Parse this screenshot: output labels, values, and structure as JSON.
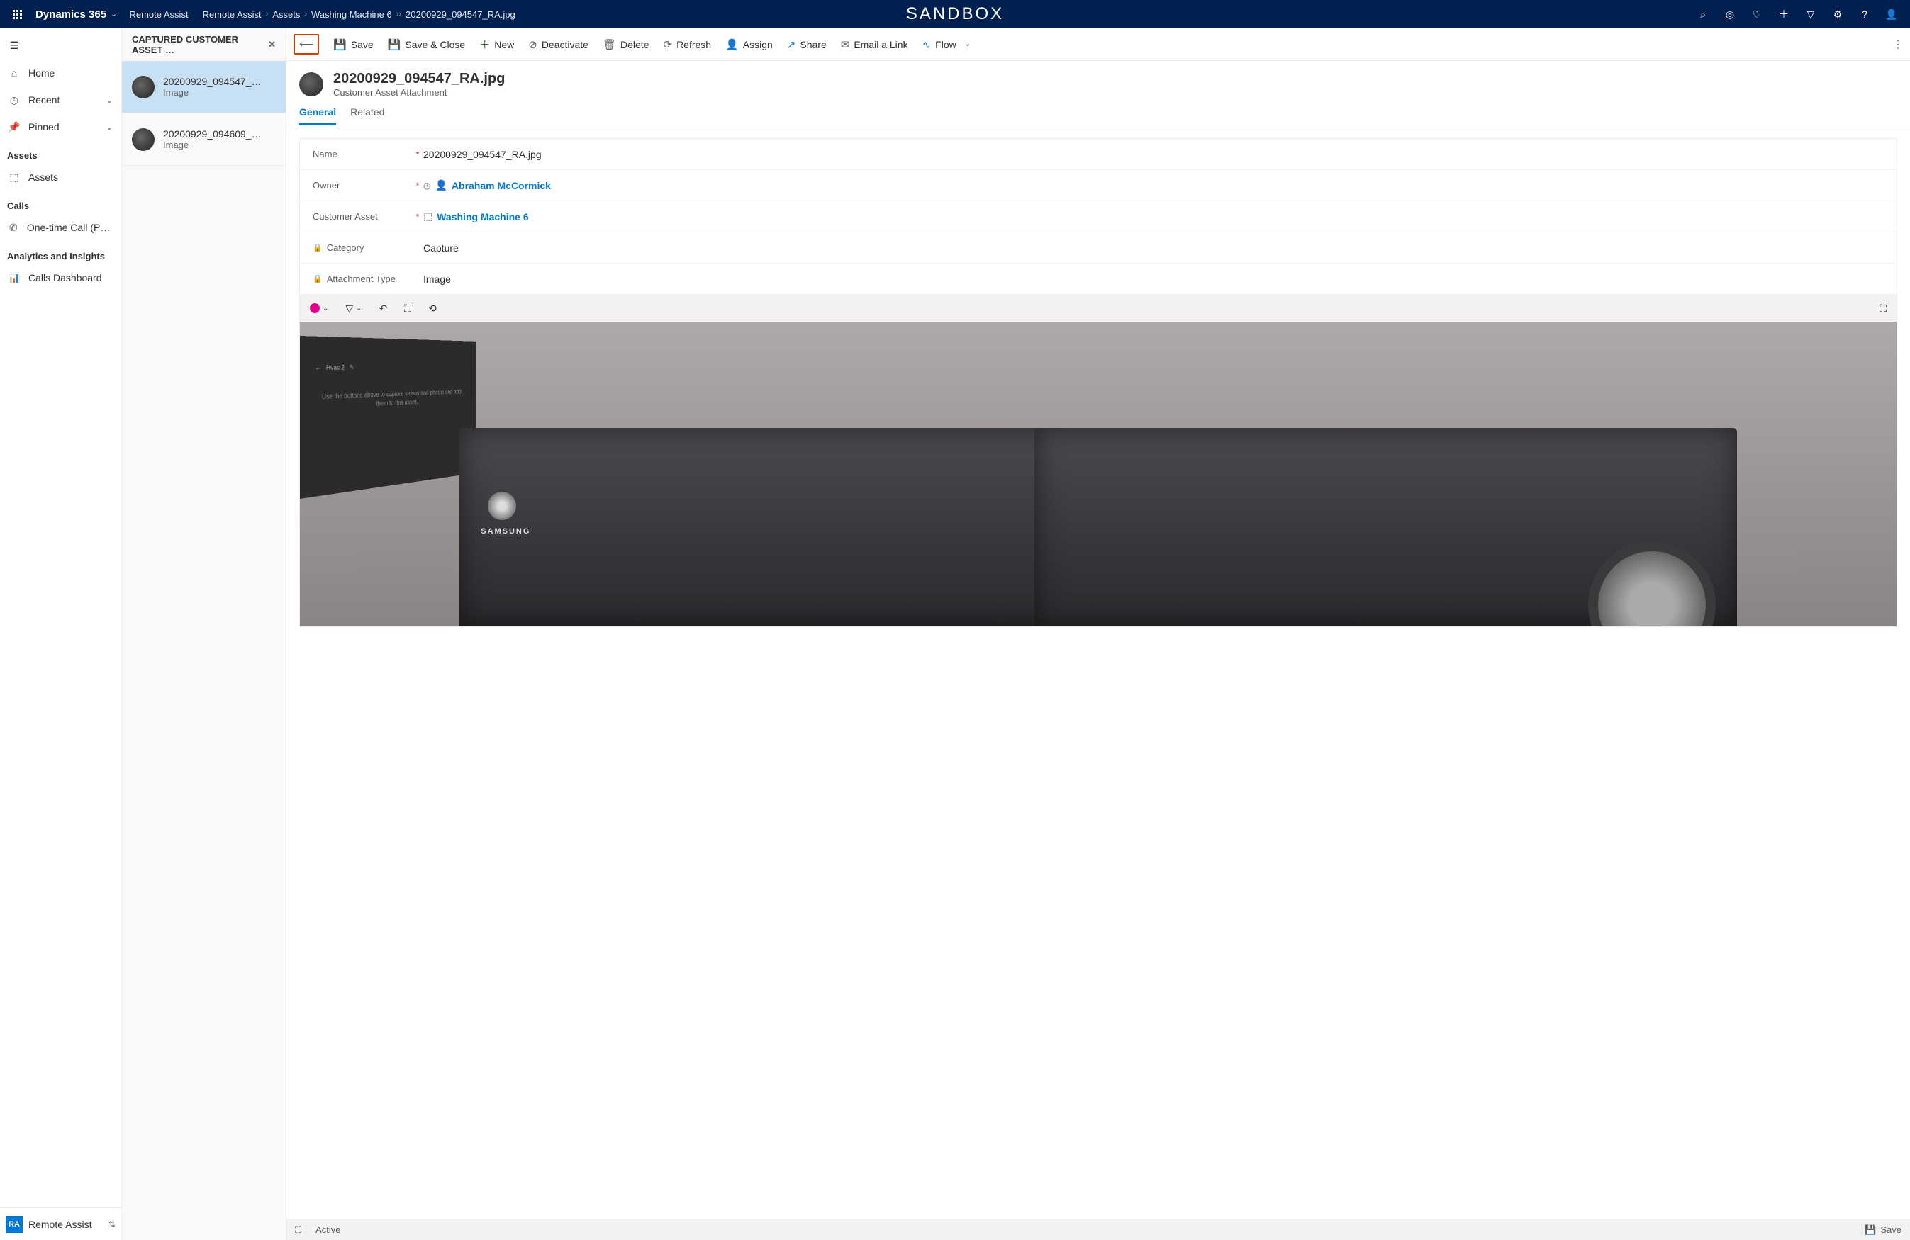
{
  "top": {
    "brand": "Dynamics 365",
    "sandbox": "SANDBOX",
    "breadcrumb": [
      "Remote Assist",
      "Remote Assist",
      "Assets",
      "Washing Machine 6",
      "20200929_094547_RA.jpg"
    ]
  },
  "leftnav": {
    "items_top": [
      {
        "label": "Home",
        "icon": "⌂"
      },
      {
        "label": "Recent",
        "icon": "◷",
        "caret": true
      },
      {
        "label": "Pinned",
        "icon": "📌",
        "caret": true
      }
    ],
    "section_assets": "Assets",
    "item_assets": "Assets",
    "section_calls": "Calls",
    "item_calls": "One-time Call (Previ…",
    "section_analytics": "Analytics and Insights",
    "item_dashboard": "Calls Dashboard",
    "footer_badge": "RA",
    "footer_label": "Remote Assist"
  },
  "list": {
    "header": "CAPTURED CUSTOMER ASSET …",
    "items": [
      {
        "title": "20200929_094547_…",
        "sub": "Image"
      },
      {
        "title": "20200929_094609_…",
        "sub": "Image"
      }
    ]
  },
  "commandbar": {
    "save": "Save",
    "save_close": "Save & Close",
    "new": "New",
    "deactivate": "Deactivate",
    "delete": "Delete",
    "refresh": "Refresh",
    "assign": "Assign",
    "share": "Share",
    "email": "Email a Link",
    "flow": "Flow"
  },
  "record": {
    "title": "20200929_094547_RA.jpg",
    "subtitle": "Customer Asset Attachment"
  },
  "tabs": {
    "general": "General",
    "related": "Related"
  },
  "form": {
    "name_label": "Name",
    "name_value": "20200929_094547_RA.jpg",
    "owner_label": "Owner",
    "owner_value": "Abraham McCormick",
    "asset_label": "Customer Asset",
    "asset_value": "Washing Machine 6",
    "category_label": "Category",
    "category_value": "Capture",
    "attachtype_label": "Attachment Type",
    "attachtype_value": "Image",
    "image_panel_text": "Use the buttons above to capture videos and photos and add them to this asset.",
    "image_panel_header": "Hvac 2",
    "brand_on_appliance": "SAMSUNG"
  },
  "statusbar": {
    "status": "Active",
    "save": "Save"
  }
}
